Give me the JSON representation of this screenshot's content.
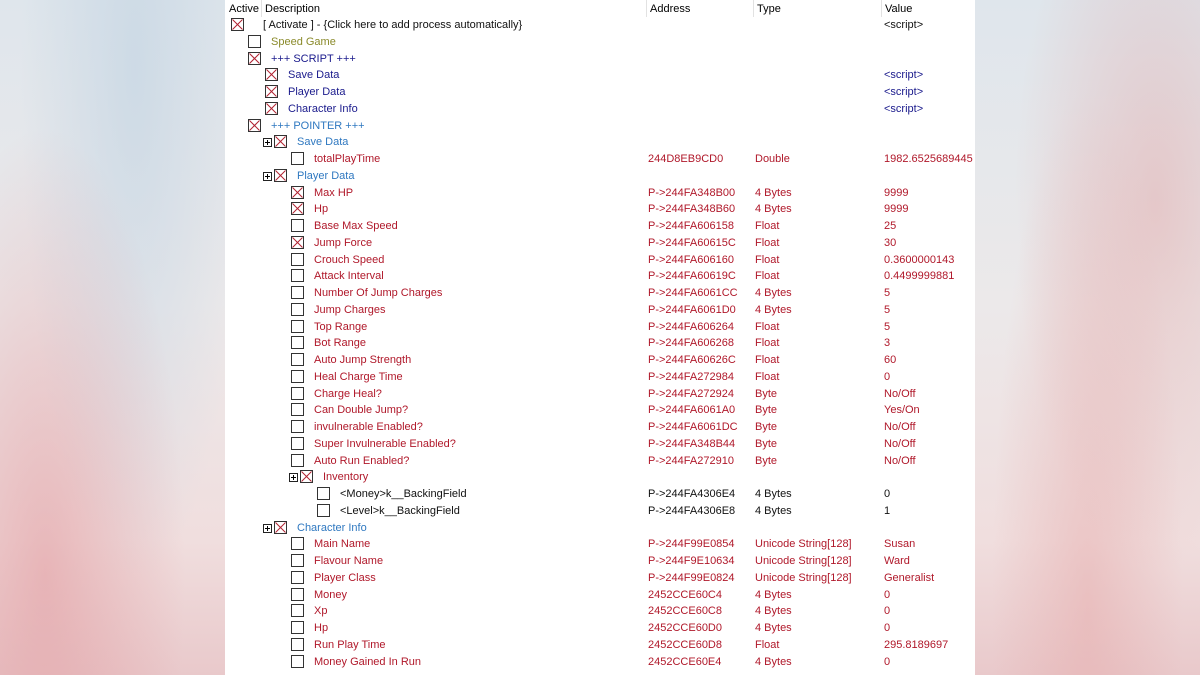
{
  "header": {
    "active": "Active",
    "description": "Description",
    "address": "Address",
    "type": "Type",
    "value": "Value"
  },
  "colors": {
    "black": "#111111",
    "olive": "#8a8a2a",
    "navy": "#1a1a8c",
    "blue": "#2f78c0",
    "red": "#b0182a"
  },
  "rows": [
    {
      "depth": 0,
      "checked": true,
      "expander": false,
      "color": "black",
      "desc": "[ Activate ] - {Click here to add process automatically}",
      "addr": "",
      "type": "",
      "value": "<script>"
    },
    {
      "depth": 1,
      "checked": false,
      "expander": false,
      "color": "olive",
      "desc": "Speed Game",
      "addr": "",
      "type": "",
      "value": ""
    },
    {
      "depth": 1,
      "checked": true,
      "expander": false,
      "color": "navy",
      "desc": "+++ SCRIPT +++",
      "addr": "",
      "type": "",
      "value": ""
    },
    {
      "depth": 2,
      "checked": true,
      "expander": false,
      "color": "navy",
      "desc": "Save Data",
      "addr": "",
      "type": "",
      "value": "<script>"
    },
    {
      "depth": 2,
      "checked": true,
      "expander": false,
      "color": "navy",
      "desc": "Player Data",
      "addr": "",
      "type": "",
      "value": "<script>"
    },
    {
      "depth": 2,
      "checked": true,
      "expander": false,
      "color": "navy",
      "desc": "Character Info",
      "addr": "",
      "type": "",
      "value": "<script>"
    },
    {
      "depth": 1,
      "checked": true,
      "expander": false,
      "color": "blue",
      "desc": "+++ POINTER +++",
      "addr": "",
      "type": "",
      "value": ""
    },
    {
      "depth": 2,
      "checked": true,
      "expander": true,
      "color": "blue",
      "desc": "Save Data",
      "addr": "",
      "type": "",
      "value": ""
    },
    {
      "depth": 3,
      "checked": false,
      "expander": false,
      "color": "red",
      "desc": "totalPlayTime",
      "addr": "244D8EB9CD0",
      "type": "Double",
      "value": "1982.6525689445"
    },
    {
      "depth": 2,
      "checked": true,
      "expander": true,
      "color": "blue",
      "desc": "Player Data",
      "addr": "",
      "type": "",
      "value": ""
    },
    {
      "depth": 3,
      "checked": true,
      "expander": false,
      "color": "red",
      "desc": "Max HP",
      "addr": "P->244FA348B00",
      "type": "4 Bytes",
      "value": "9999"
    },
    {
      "depth": 3,
      "checked": true,
      "expander": false,
      "color": "red",
      "desc": "Hp",
      "addr": "P->244FA348B60",
      "type": "4 Bytes",
      "value": "9999"
    },
    {
      "depth": 3,
      "checked": false,
      "expander": false,
      "color": "red",
      "desc": "Base Max Speed",
      "addr": "P->244FA606158",
      "type": "Float",
      "value": "25"
    },
    {
      "depth": 3,
      "checked": true,
      "expander": false,
      "color": "red",
      "desc": "Jump Force",
      "addr": "P->244FA60615C",
      "type": "Float",
      "value": "30"
    },
    {
      "depth": 3,
      "checked": false,
      "expander": false,
      "color": "red",
      "desc": "Crouch Speed",
      "addr": "P->244FA606160",
      "type": "Float",
      "value": "0.3600000143"
    },
    {
      "depth": 3,
      "checked": false,
      "expander": false,
      "color": "red",
      "desc": "Attack Interval",
      "addr": "P->244FA60619C",
      "type": "Float",
      "value": "0.4499999881"
    },
    {
      "depth": 3,
      "checked": false,
      "expander": false,
      "color": "red",
      "desc": "Number Of Jump Charges",
      "addr": "P->244FA6061CC",
      "type": "4 Bytes",
      "value": "5"
    },
    {
      "depth": 3,
      "checked": false,
      "expander": false,
      "color": "red",
      "desc": "Jump Charges",
      "addr": "P->244FA6061D0",
      "type": "4 Bytes",
      "value": "5"
    },
    {
      "depth": 3,
      "checked": false,
      "expander": false,
      "color": "red",
      "desc": "Top Range",
      "addr": "P->244FA606264",
      "type": "Float",
      "value": "5"
    },
    {
      "depth": 3,
      "checked": false,
      "expander": false,
      "color": "red",
      "desc": "Bot Range",
      "addr": "P->244FA606268",
      "type": "Float",
      "value": "3"
    },
    {
      "depth": 3,
      "checked": false,
      "expander": false,
      "color": "red",
      "desc": "Auto Jump Strength",
      "addr": "P->244FA60626C",
      "type": "Float",
      "value": "60"
    },
    {
      "depth": 3,
      "checked": false,
      "expander": false,
      "color": "red",
      "desc": "Heal Charge Time",
      "addr": "P->244FA272984",
      "type": "Float",
      "value": "0"
    },
    {
      "depth": 3,
      "checked": false,
      "expander": false,
      "color": "red",
      "desc": "Charge Heal?",
      "addr": "P->244FA272924",
      "type": "Byte",
      "value": "No/Off"
    },
    {
      "depth": 3,
      "checked": false,
      "expander": false,
      "color": "red",
      "desc": "Can Double Jump?",
      "addr": "P->244FA6061A0",
      "type": "Byte",
      "value": "Yes/On"
    },
    {
      "depth": 3,
      "checked": false,
      "expander": false,
      "color": "red",
      "desc": "invulnerable Enabled?",
      "addr": "P->244FA6061DC",
      "type": "Byte",
      "value": "No/Off"
    },
    {
      "depth": 3,
      "checked": false,
      "expander": false,
      "color": "red",
      "desc": "Super Invulnerable Enabled?",
      "addr": "P->244FA348B44",
      "type": "Byte",
      "value": "No/Off"
    },
    {
      "depth": 3,
      "checked": false,
      "expander": false,
      "color": "red",
      "desc": "Auto Run Enabled?",
      "addr": "P->244FA272910",
      "type": "Byte",
      "value": "No/Off"
    },
    {
      "depth": 3,
      "checked": true,
      "expander": true,
      "color": "red",
      "desc": "Inventory",
      "addr": "",
      "type": "",
      "value": ""
    },
    {
      "depth": 4,
      "checked": false,
      "expander": false,
      "color": "black",
      "desc": "<Money>k__BackingField",
      "addr": "P->244FA4306E4",
      "type": "4 Bytes",
      "value": "0"
    },
    {
      "depth": 4,
      "checked": false,
      "expander": false,
      "color": "black",
      "desc": "<Level>k__BackingField",
      "addr": "P->244FA4306E8",
      "type": "4 Bytes",
      "value": "1"
    },
    {
      "depth": 2,
      "checked": true,
      "expander": true,
      "color": "blue",
      "desc": "Character Info",
      "addr": "",
      "type": "",
      "value": ""
    },
    {
      "depth": 3,
      "checked": false,
      "expander": false,
      "color": "red",
      "desc": "Main Name",
      "addr": "P->244F99E0854",
      "type": "Unicode String[128]",
      "value": "Susan"
    },
    {
      "depth": 3,
      "checked": false,
      "expander": false,
      "color": "red",
      "desc": "Flavour Name",
      "addr": "P->244F9E10634",
      "type": "Unicode String[128]",
      "value": "Ward"
    },
    {
      "depth": 3,
      "checked": false,
      "expander": false,
      "color": "red",
      "desc": "Player Class",
      "addr": "P->244F99E0824",
      "type": "Unicode String[128]",
      "value": "Generalist"
    },
    {
      "depth": 3,
      "checked": false,
      "expander": false,
      "color": "red",
      "desc": "Money",
      "addr": "2452CCE60C4",
      "type": "4 Bytes",
      "value": "0"
    },
    {
      "depth": 3,
      "checked": false,
      "expander": false,
      "color": "red",
      "desc": "Xp",
      "addr": "2452CCE60C8",
      "type": "4 Bytes",
      "value": "0"
    },
    {
      "depth": 3,
      "checked": false,
      "expander": false,
      "color": "red",
      "desc": "Hp",
      "addr": "2452CCE60D0",
      "type": "4 Bytes",
      "value": "0"
    },
    {
      "depth": 3,
      "checked": false,
      "expander": false,
      "color": "red",
      "desc": "Run Play Time",
      "addr": "2452CCE60D8",
      "type": "Float",
      "value": "295.8189697"
    },
    {
      "depth": 3,
      "checked": false,
      "expander": false,
      "color": "red",
      "desc": "Money Gained In Run",
      "addr": "2452CCE60E4",
      "type": "4 Bytes",
      "value": "0"
    }
  ]
}
